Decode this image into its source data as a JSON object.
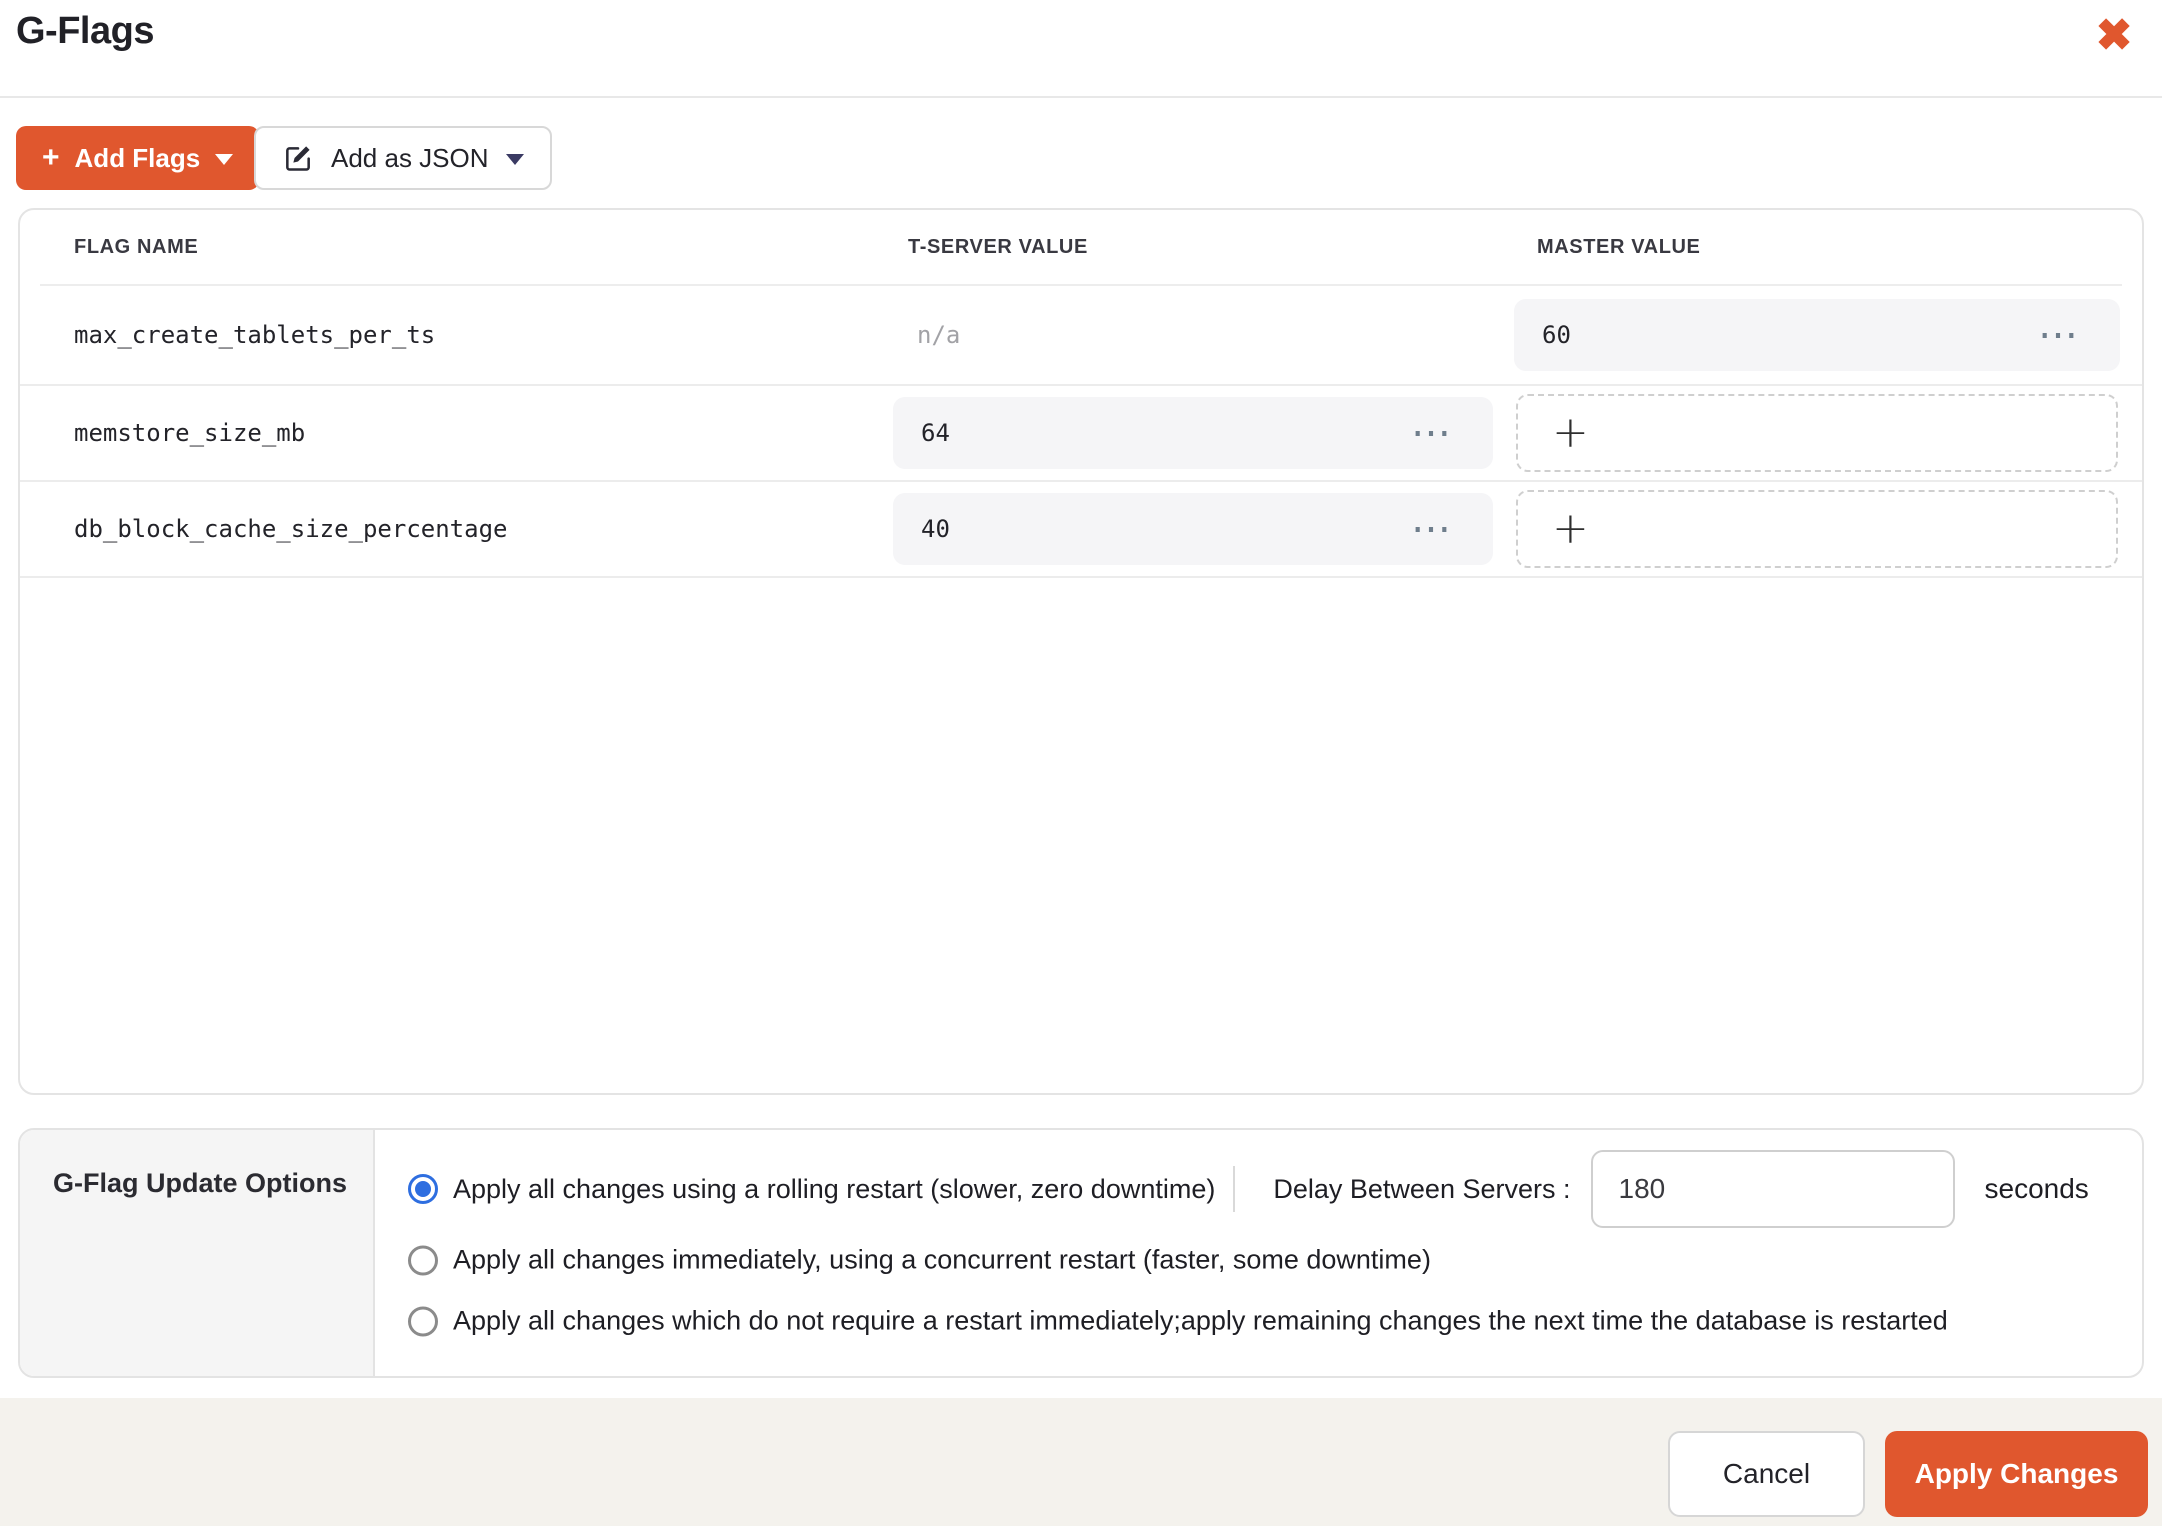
{
  "header": {
    "title": "G-Flags"
  },
  "icons": {
    "plus": "+",
    "add_value_plus": "+",
    "ellipsis": "⋯",
    "close": "✖"
  },
  "toolbar": {
    "add_flags_label": "Add Flags",
    "add_json_label": "Add as JSON"
  },
  "table": {
    "columns": {
      "flag_name": "FLAG NAME",
      "tserver": "T-SERVER VALUE",
      "master": "MASTER VALUE"
    },
    "rows": [
      {
        "name": "max_create_tablets_per_ts",
        "tserver_value": "n/a",
        "master_value": "60"
      },
      {
        "name": "memstore_size_mb",
        "tserver_value": "64",
        "master_value": ""
      },
      {
        "name": "db_block_cache_size_percentage",
        "tserver_value": "40",
        "master_value": ""
      }
    ]
  },
  "options": {
    "title": "G-Flag Update Options",
    "radios": [
      {
        "label": "Apply all changes using a rolling restart (slower, zero downtime)",
        "selected": true
      },
      {
        "label": "Apply all changes immediately, using a concurrent restart (faster, some downtime)",
        "selected": false
      },
      {
        "label": "Apply all changes which do not require a restart immediately;apply remaining changes the next time the database is restarted",
        "selected": false
      }
    ],
    "delay": {
      "label": "Delay Between Servers :",
      "value": "180",
      "unit": "seconds"
    }
  },
  "footer": {
    "cancel_label": "Cancel",
    "apply_label": "Apply Changes"
  },
  "colors": {
    "accent": "#e0572e",
    "radio_selected": "#2e6ee0",
    "footer_bg": "#f4f2ed"
  }
}
